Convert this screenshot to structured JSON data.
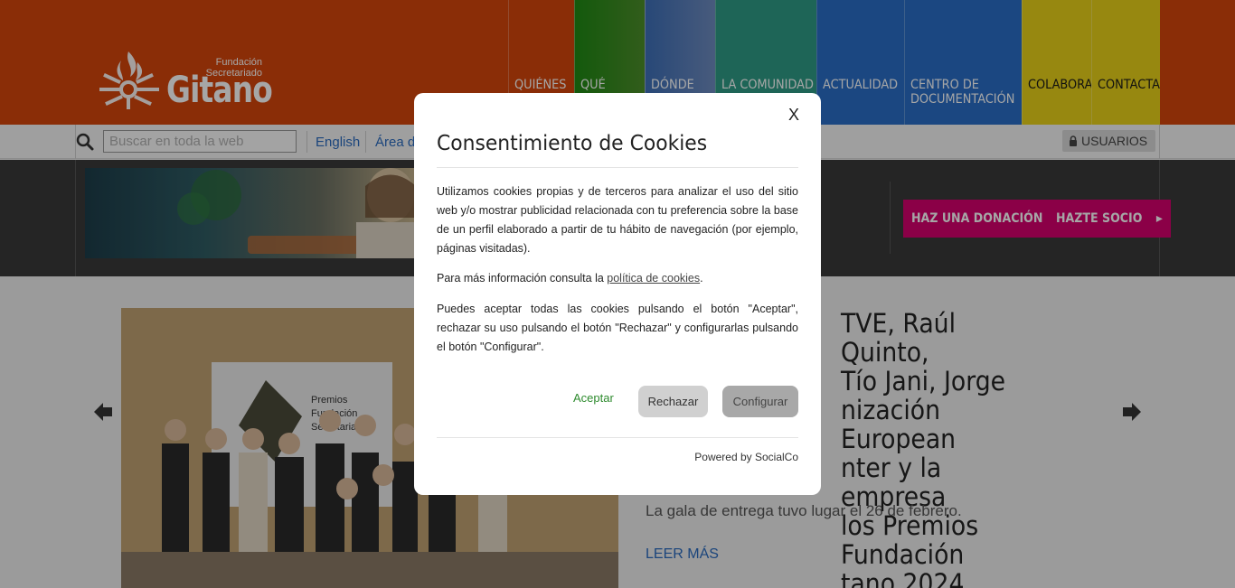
{
  "header": {
    "logo": {
      "subtitle_line1": "Fundación",
      "subtitle_line2": "Secretariado",
      "name": "Gitano"
    },
    "nav": [
      {
        "label": "QUIÉNES",
        "color": "#d4460c"
      },
      {
        "label": "QUÉ",
        "color": "#3a8a1e"
      },
      {
        "label": "DÓNDE",
        "color": "#4f7fc4"
      },
      {
        "label": "LA COMUNIDAD",
        "color": "#2f9c86"
      },
      {
        "label": "ACTUALIDAD",
        "color": "#2a6ec7"
      },
      {
        "label_line1": "CENTRO DE",
        "label_line2": "DOCUMENTACIÓN",
        "color": "#2a6ec7"
      },
      {
        "label": "COLABORA",
        "color": "#e8d21a"
      },
      {
        "label": "CONTACTA",
        "color": "#e8d21a"
      }
    ]
  },
  "toolbar": {
    "search_placeholder": "Buscar en toda la web",
    "english_link": "English",
    "area_link": "Área de",
    "usuarios": "USUARIOS"
  },
  "banner": {
    "donate_label": "HAZ UNA DONACIÓN",
    "member_label": "HAZTE SOCIO",
    "cta_color": "#d6006e"
  },
  "news": {
    "title": "TVE, Raúl Quinto, Tío Jani, Jorge nización European nter y la empresa los Premios Fundación tano 2024",
    "title_lines": [
      "TVE, Raúl Quinto,",
      "Tío Jani, Jorge",
      "nización European",
      "nter y la empresa",
      "los Premios Fundación",
      "tano 2024"
    ],
    "subtitle": "La gala de entrega tuvo lugar el 26 de febrero.",
    "read_more": "LEER MÁS",
    "photo_sign": "Premios Fundación Secretariado"
  },
  "cookie_modal": {
    "close_label": "X",
    "title": "Consentimiento de Cookies",
    "paragraph1": "Utilizamos cookies propias y de terceros para analizar el uso del sitio web y/o mostrar publicidad relacionada con tu preferencia sobre la base de un perfil elaborado a partir de tu hábito de navegación (por ejemplo, páginas visitadas).",
    "paragraph2_prefix": "Para más información consulta la ",
    "policy_link": "política de cookies",
    "paragraph2_suffix": ".",
    "paragraph3": "Puedes aceptar todas las cookies pulsando el botón \"Aceptar\", rechazar su uso pulsando el botón \"Rechazar\" y configurarlas pulsando el botón \"Configurar\".",
    "accept_label": "Aceptar",
    "reject_label": "Rechazar",
    "configure_label": "Configurar",
    "powered_by": "Powered by SocialCo"
  }
}
